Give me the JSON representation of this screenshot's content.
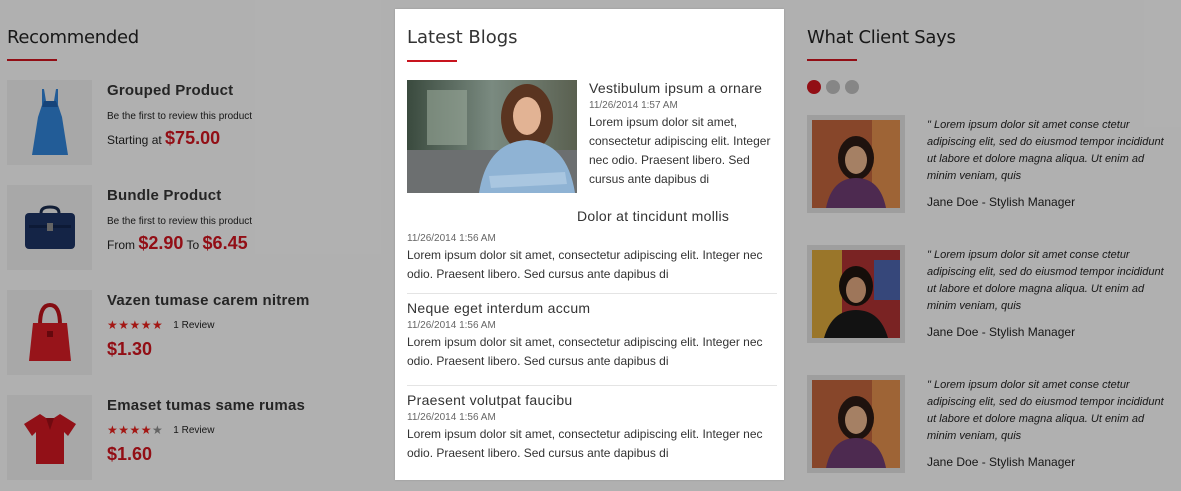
{
  "recommended": {
    "title": "Recommended",
    "items": [
      {
        "name": "Grouped Product",
        "review_text": "Be the first to review this product",
        "price_prefix": "Starting at",
        "price": "$75.00",
        "icon": "dress-icon"
      },
      {
        "name": "Bundle Product",
        "review_text": "Be the first to review this product",
        "price_from_label": "From",
        "price_from": "$2.90",
        "price_to_label": "To",
        "price_to": "$6.45",
        "icon": "briefcase-icon"
      },
      {
        "name": "Vazen tumase carem nitrem",
        "rating": 5,
        "review_count": "1 Review",
        "price": "$1.30",
        "icon": "handbag-icon"
      },
      {
        "name": "Emaset tumas same rumas",
        "rating": 4,
        "review_count": "1 Review",
        "price": "$1.60",
        "icon": "polo-shirt-icon"
      }
    ]
  },
  "blogs": {
    "title": "Latest Blogs",
    "posts": [
      {
        "title": "Vestibulum ipsum a ornare",
        "date": "11/26/2014 1:57 AM",
        "excerpt": "Lorem ipsum dolor sit amet, consectetur adipiscing elit. Integer nec odio. Praesent libero. Sed cursus ante dapibus di"
      },
      {
        "title": "Dolor at tincidunt mollis",
        "date": "11/26/2014 1:56 AM",
        "excerpt": "Lorem ipsum dolor sit amet, consectetur adipiscing elit. Integer nec odio. Praesent libero. Sed cursus ante dapibus di"
      },
      {
        "title": "Neque eget interdum accum",
        "date": "11/26/2014 1:56 AM",
        "excerpt": "Lorem ipsum dolor sit amet, consectetur adipiscing elit. Integer nec odio. Praesent libero. Sed cursus ante dapibus di"
      },
      {
        "title": "Praesent volutpat faucibu",
        "date": "11/26/2014 1:56 AM",
        "excerpt": "Lorem ipsum dolor sit amet, consectetur adipiscing elit. Integer nec odio. Praesent libero. Sed cursus ante dapibus di"
      }
    ]
  },
  "clients": {
    "title": "What Client Says",
    "testimonials": [
      {
        "text": "\" Lorem ipsum dolor sit amet conse ctetur adipiscing elit, sed do eiusmod tempor incididunt ut labore et dolore magna aliqua. Ut enim ad minim veniam, quis",
        "author": "Jane Doe - Stylish Manager"
      },
      {
        "text": "\" Lorem ipsum dolor sit amet conse ctetur adipiscing elit, sed do eiusmod tempor incididunt ut labore et dolore magna aliqua. Ut enim ad minim veniam, quis",
        "author": "Jane Doe - Stylish Manager"
      },
      {
        "text": "\" Lorem ipsum dolor sit amet conse ctetur adipiscing elit, sed do eiusmod tempor incididunt ut labore et dolore magna aliqua. Ut enim ad minim veniam, quis",
        "author": "Jane Doe - Stylish Manager"
      }
    ]
  },
  "colors": {
    "accent": "#c8141e",
    "overlay": "rgba(0,0,0,0.27)"
  }
}
